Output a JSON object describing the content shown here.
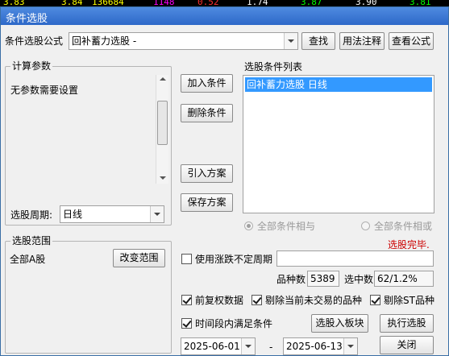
{
  "background_ticker": {
    "values": [
      "3.83",
      "3.84",
      "136684",
      "1148",
      "0.52",
      "1.74",
      "3.87",
      "3.90",
      "3.81"
    ],
    "colors": [
      "#ffff00",
      "#ffff00",
      "#ffff00",
      "#ff00ff",
      "#ff3030",
      "#ffffff",
      "#00ff00",
      "#ffffff",
      "#00ff00"
    ]
  },
  "window": {
    "title": "条件选股"
  },
  "formula": {
    "label": "条件选股公式",
    "selected": "回补蓄力选股 -",
    "find_button": "查找",
    "usage_button": "用法注释",
    "view_button": "查看公式"
  },
  "params": {
    "group_title": "计算参数",
    "message": "无参数需要设置",
    "period_label": "选股周期:",
    "period_value": "日线"
  },
  "actions": {
    "add_condition": "加入条件",
    "delete_condition": "删除条件",
    "import_plan": "引入方案",
    "save_plan": "保存方案"
  },
  "conditions": {
    "list_title": "选股条件列表",
    "items": [
      "回补蓄力选股  日线"
    ],
    "radio_and": "全部条件相与",
    "radio_or": "全部条件相或"
  },
  "status": {
    "done_text": "选股完毕.",
    "done_color": "#cc0000"
  },
  "scope": {
    "group_title": "选股范围",
    "value": "全部A股",
    "change_button": "改变范围"
  },
  "uncertain_period": {
    "label": "使用涨跌不定周期",
    "checked": false,
    "value": ""
  },
  "stats": {
    "count_label": "品种数",
    "count_value": "5389",
    "hit_label": "选中数",
    "hit_value": "62/1.2%"
  },
  "options": {
    "forward_adjust": {
      "label": "前复权数据",
      "checked": true
    },
    "exclude_untraded": {
      "label": "剔除当前未交易的品种",
      "checked": true
    },
    "exclude_st": {
      "label": "剔除ST品种",
      "checked": true
    },
    "time_range": {
      "label": "时间段内满足条件",
      "checked": true
    }
  },
  "buttons": {
    "add_to_block": "选股入板块",
    "run": "执行选股",
    "close": "关闭"
  },
  "date_range": {
    "start": "2025-06-01",
    "separator": "-",
    "end": "2025-06-13"
  }
}
